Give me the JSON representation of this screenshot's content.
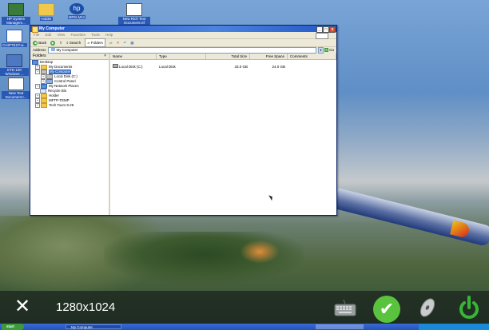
{
  "desktop": {
    "icons": [
      {
        "label": "HP System Managem..."
      },
      {
        "label": "Holder"
      },
      {
        "label": "MFELM11"
      },
      {
        "label": "New Rich Text Document.rtf"
      },
      {
        "label": "CHIPTEST.w..."
      },
      {
        "label": "ETD 100 Windows ..."
      },
      {
        "label": "New Text Document.t..."
      }
    ]
  },
  "window": {
    "title": "My Computer",
    "menu": [
      "File",
      "Edit",
      "View",
      "Favorites",
      "Tools",
      "Help"
    ],
    "toolbar": {
      "back": "Back",
      "search": "Search",
      "folders": "Folders"
    },
    "address": {
      "label": "Address",
      "value": "My Computer",
      "go": "Go"
    },
    "folders_pane": {
      "title": "Folders",
      "close": "×",
      "tree": [
        "Desktop",
        "My Documents",
        "My Computer",
        "Local Disk (C:)",
        "Control Panel",
        "My Network Places",
        "Recycle Bin",
        "Holder",
        "MFTP-TEMP",
        "Tech Tours 9-28"
      ]
    },
    "files": {
      "columns": [
        "Name",
        "Type",
        "Total Size",
        "Free Space",
        "Comments"
      ],
      "rows": [
        {
          "name": "Local Disk (C:)",
          "type": "Local Disk",
          "total": "33.0 GB",
          "free": "24.0 GB",
          "comments": ""
        }
      ]
    }
  },
  "overlay": {
    "close_glyph": "✕",
    "resolution": "1280x1024"
  },
  "taskbar": {
    "start": "start",
    "task": "My Computer"
  }
}
